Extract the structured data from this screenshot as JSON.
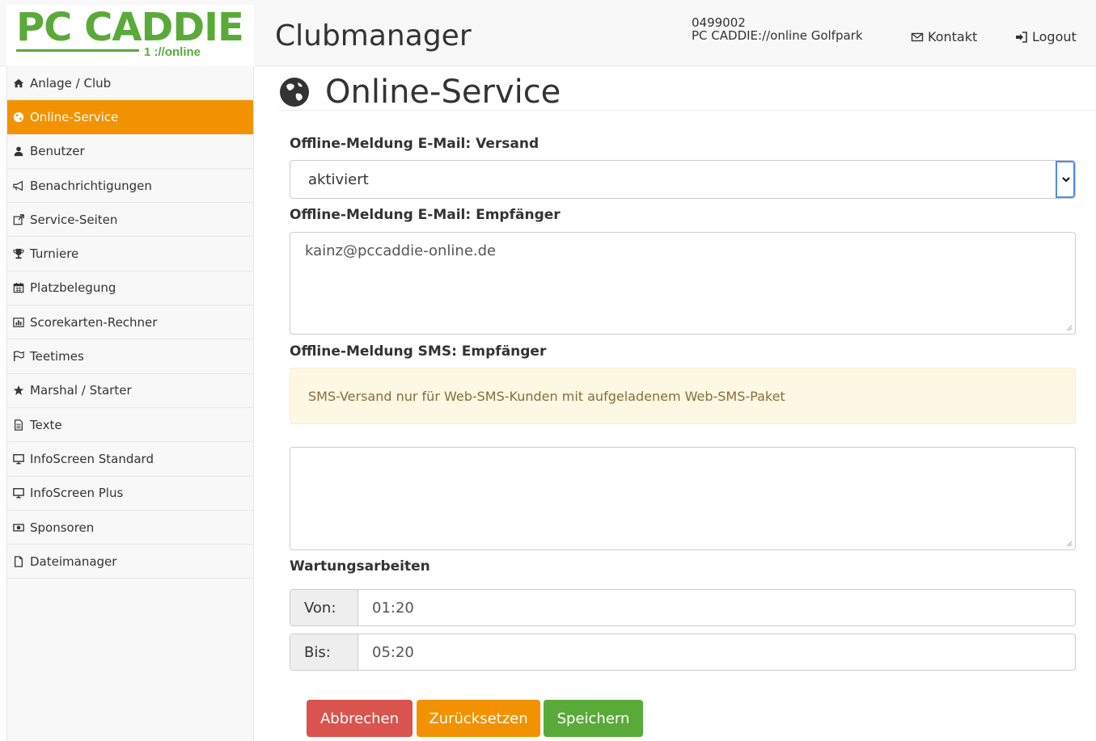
{
  "header": {
    "logo_text": "PC CADDIE",
    "logo_sub": "1 ://online",
    "app_title": "Clubmanager",
    "club_id": "0499002",
    "club_name": "PC CADDIE://online Golfpark",
    "contact_label": "Kontakt",
    "logout_label": "Logout"
  },
  "sidebar": {
    "items": [
      {
        "label": "Anlage / Club",
        "icon": "home-icon"
      },
      {
        "label": "Online-Service",
        "icon": "globe-icon",
        "active": true
      },
      {
        "label": "Benutzer",
        "icon": "user-icon"
      },
      {
        "label": "Benachrichtigungen",
        "icon": "bullhorn-icon"
      },
      {
        "label": "Service-Seiten",
        "icon": "external-link-icon"
      },
      {
        "label": "Turniere",
        "icon": "trophy-icon"
      },
      {
        "label": "Platzbelegung",
        "icon": "calendar-icon"
      },
      {
        "label": "Scorekarten-Rechner",
        "icon": "bar-chart-icon"
      },
      {
        "label": "Teetimes",
        "icon": "flag-icon"
      },
      {
        "label": "Marshal / Starter",
        "icon": "star-icon"
      },
      {
        "label": "Texte",
        "icon": "document-text-icon"
      },
      {
        "label": "InfoScreen Standard",
        "icon": "monitor-icon"
      },
      {
        "label": "InfoScreen Plus",
        "icon": "monitor-icon"
      },
      {
        "label": "Sponsoren",
        "icon": "money-icon"
      },
      {
        "label": "Dateimanager",
        "icon": "file-icon"
      }
    ]
  },
  "main": {
    "title": "Online-Service",
    "email_versand_label": "Offline-Meldung E-Mail: Versand",
    "email_versand_value": "aktiviert",
    "email_empfaenger_label": "Offline-Meldung E-Mail: Empfänger",
    "email_empfaenger_value": "kainz@pccaddie-online.de",
    "sms_label": "Offline-Meldung SMS: Empfänger",
    "sms_alert": "SMS-Versand nur für Web-SMS-Kunden mit aufgeladenem Web-SMS-Paket",
    "sms_value": "",
    "wartung_label": "Wartungsarbeiten",
    "von_label": "Von:",
    "von_value": "01:20",
    "bis_label": "Bis:",
    "bis_value": "05:20",
    "cancel_label": "Abbrechen",
    "reset_label": "Zurücksetzen",
    "save_label": "Speichern"
  },
  "colors": {
    "brand_green": "#5aaa39",
    "active_orange": "#f39200",
    "danger_red": "#d9534f",
    "alert_bg": "#fcf8e3"
  }
}
